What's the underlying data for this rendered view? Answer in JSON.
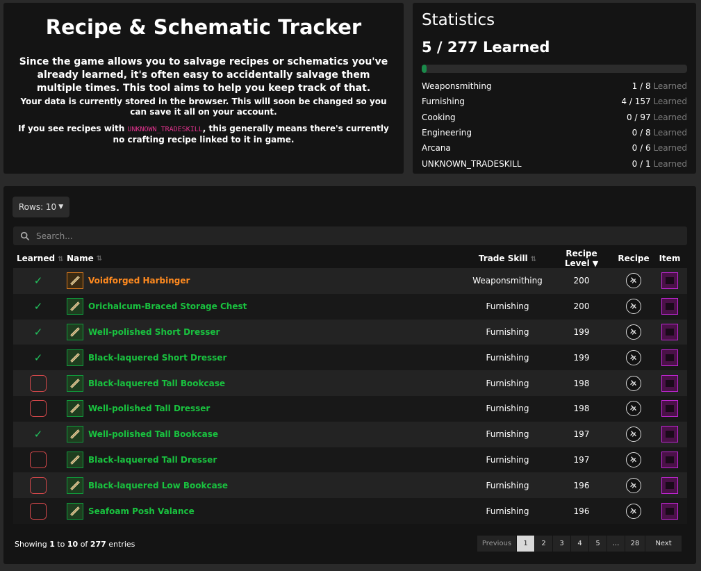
{
  "intro": {
    "title": "Recipe & Schematic Tracker",
    "lead": "Since the game allows you to salvage recipes or schematics you've already learned, it's often easy to accidentally salvage them multiple times. This tool aims to help you keep track of that.",
    "note1": "Your data is currently stored in the browser. This will soon be changed so you can save it all on your account.",
    "note2_before": "If you see recipes with ",
    "note2_code": "UNKNOWN_TRADESKILL",
    "note2_after": ", this generally means there's currently no crafting recipe linked to it in game."
  },
  "stats": {
    "title": "Statistics",
    "total": "5 / 277 Learned",
    "progress": 0.018,
    "learned_word": "Learned",
    "rows": [
      {
        "name": "Weaponsmithing",
        "count": "1 / 8"
      },
      {
        "name": "Furnishing",
        "count": "4 / 157"
      },
      {
        "name": "Cooking",
        "count": "0 / 97"
      },
      {
        "name": "Engineering",
        "count": "0 / 8"
      },
      {
        "name": "Arcana",
        "count": "0 / 6"
      },
      {
        "name": "UNKNOWN_TRADESKILL",
        "count": "0 / 1"
      }
    ]
  },
  "table": {
    "rows_label": "Rows: 10",
    "search_placeholder": "Search...",
    "headers": {
      "learned": "Learned",
      "name": "Name",
      "skill": "Trade Skill",
      "level": "Recipe Level",
      "recipe": "Recipe",
      "item": "Item"
    },
    "rows": [
      {
        "learned": true,
        "name": "Voidforged Harbinger",
        "rarity": "orange",
        "skill": "Weaponsmithing",
        "level": "200"
      },
      {
        "learned": true,
        "name": "Orichalcum-Braced Storage Chest",
        "rarity": "green",
        "skill": "Furnishing",
        "level": "200"
      },
      {
        "learned": true,
        "name": "Well-polished Short Dresser",
        "rarity": "green",
        "skill": "Furnishing",
        "level": "199"
      },
      {
        "learned": true,
        "name": "Black-laquered Short Dresser",
        "rarity": "green",
        "skill": "Furnishing",
        "level": "199"
      },
      {
        "learned": false,
        "name": "Black-laquered Tall Bookcase",
        "rarity": "green",
        "skill": "Furnishing",
        "level": "198"
      },
      {
        "learned": false,
        "name": "Well-polished Tall Dresser",
        "rarity": "green",
        "skill": "Furnishing",
        "level": "198"
      },
      {
        "learned": true,
        "name": "Well-polished Tall Bookcase",
        "rarity": "green",
        "skill": "Furnishing",
        "level": "197"
      },
      {
        "learned": false,
        "name": "Black-laquered Tall Dresser",
        "rarity": "green",
        "skill": "Furnishing",
        "level": "197"
      },
      {
        "learned": false,
        "name": "Black-laquered Low Bookcase",
        "rarity": "green",
        "skill": "Furnishing",
        "level": "196"
      },
      {
        "learned": false,
        "name": "Seafoam Posh Valance",
        "rarity": "green",
        "skill": "Furnishing",
        "level": "196"
      }
    ],
    "footer": {
      "prefix": "Showing ",
      "from": "1",
      "to_word": " to ",
      "to": "10",
      "of_word": " of ",
      "total": "277",
      "suffix": " entries"
    },
    "pagination": {
      "previous": "Previous",
      "pages": [
        "1",
        "2",
        "3",
        "4",
        "5",
        "...",
        "28"
      ],
      "active": "1",
      "next": "Next"
    }
  },
  "colors": {
    "accent_green": "#19c23f",
    "accent_orange": "#ff8a1f",
    "unlearned_red": "#d9494c",
    "item_magenta": "#c026d3"
  }
}
